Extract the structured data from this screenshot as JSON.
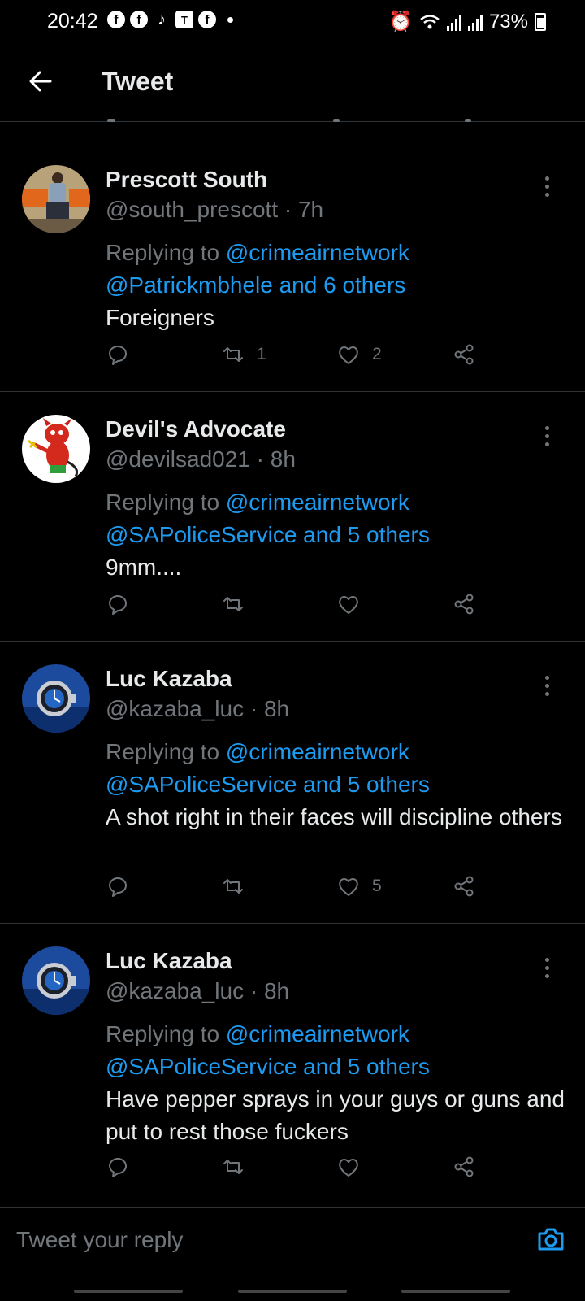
{
  "status_bar": {
    "time": "20:42",
    "notification_icons": [
      "facebook-icon",
      "facebook-icon",
      "tiktok-icon",
      "teams-icon",
      "facebook-icon"
    ],
    "battery": "73%"
  },
  "header": {
    "title": "Tweet"
  },
  "tweets": [
    {
      "name": "Prescott South",
      "handle": "@south_prescott · 7h",
      "replying_prefix": "Replying to ",
      "replying_first": "@crimeairnetwork",
      "replying_second": "@Patrickmbhele and 6 others",
      "text": "Foreigners",
      "retweets": "1",
      "likes": "2"
    },
    {
      "name": "Devil's Advocate",
      "handle": "@devilsad021 · 8h",
      "replying_prefix": "Replying to ",
      "replying_first": "@crimeairnetwork",
      "replying_second": "@SAPoliceService and 5 others",
      "text": "9mm....",
      "retweets": "",
      "likes": ""
    },
    {
      "name": "Luc Kazaba",
      "handle": "@kazaba_luc · 8h",
      "replying_prefix": "Replying to ",
      "replying_first": "@crimeairnetwork",
      "replying_second": "@SAPoliceService and 5 others",
      "text": "A shot right in their faces will discipline others",
      "retweets": "",
      "likes": "5"
    },
    {
      "name": "Luc Kazaba",
      "handle": "@kazaba_luc · 8h",
      "replying_prefix": "Replying to ",
      "replying_first": "@crimeairnetwork",
      "replying_second": "@SAPoliceService and 5 others",
      "text": "Have pepper sprays in your guys or guns and put to rest those fuckers",
      "retweets": "",
      "likes": ""
    }
  ],
  "reply_bar": {
    "placeholder": "Tweet your reply"
  },
  "colors": {
    "background": "#000000",
    "link": "#1d9bf0",
    "muted": "#71767b",
    "text": "#e7e9ea"
  }
}
